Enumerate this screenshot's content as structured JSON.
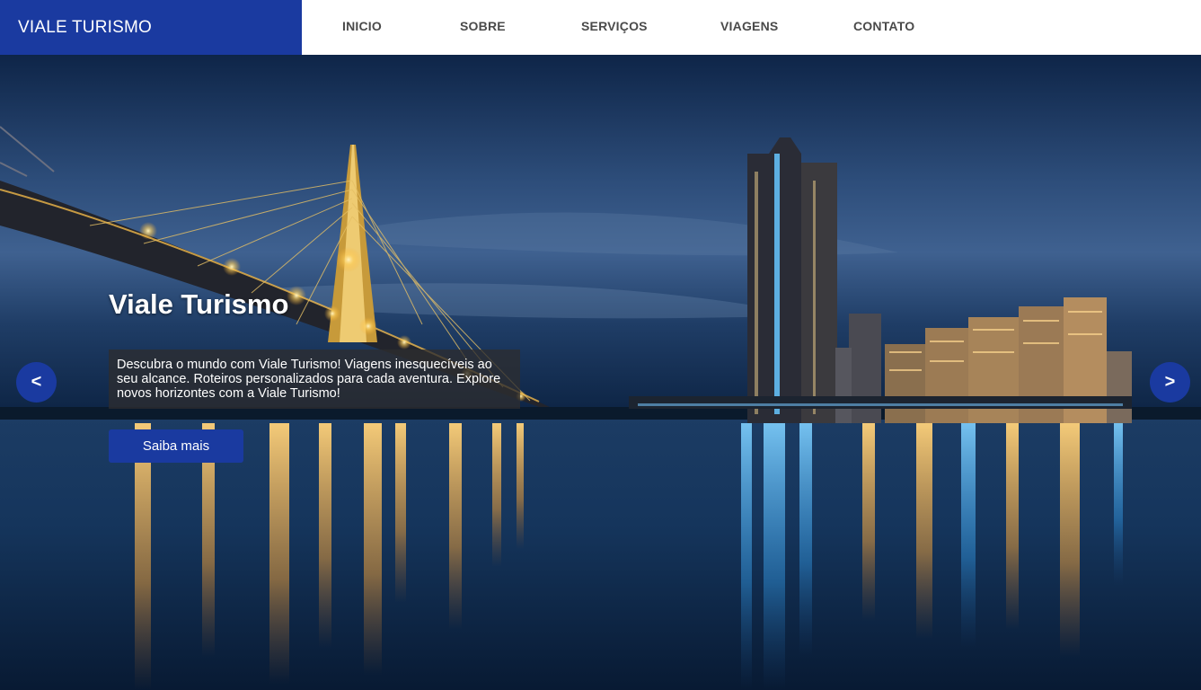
{
  "brand": {
    "name": "VIALE TURISMO"
  },
  "nav": {
    "items": [
      {
        "label": "INICIO"
      },
      {
        "label": "SOBRE"
      },
      {
        "label": "SERVIÇOS"
      },
      {
        "label": "VIAGENS"
      },
      {
        "label": "CONTATO"
      }
    ]
  },
  "hero": {
    "title": "Viale Turismo",
    "description": "Descubra o mundo com Viale Turismo! Viagens inesquecíveis ao seu alcance. Roteiros personalizados para cada aventura. Explore novos horizontes com a Viale Turismo!",
    "cta_label": "Saiba mais",
    "prev_label": "<",
    "next_label": ">"
  },
  "colors": {
    "brand_blue": "#1a3aa0",
    "nav_text": "#4a4a4a",
    "header_bg": "#ffffff"
  }
}
